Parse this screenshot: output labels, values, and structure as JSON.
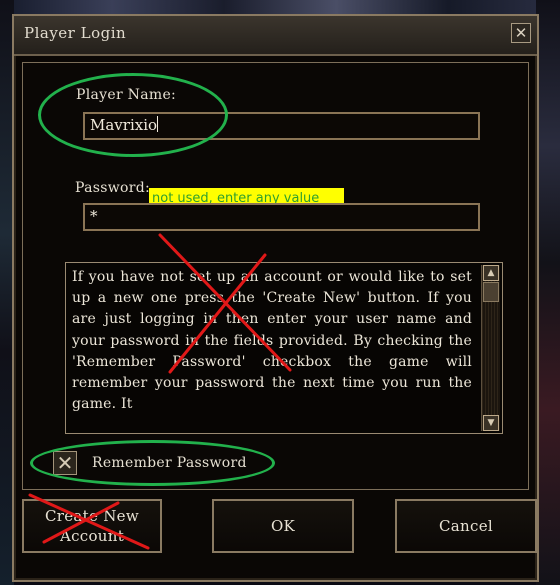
{
  "window": {
    "title": "Player Login",
    "close_glyph": "✕"
  },
  "form": {
    "player_name_label": "Player Name:",
    "player_name_value": "Mavrixio",
    "password_label": "Password:",
    "password_value": "*"
  },
  "annotation": {
    "password_note": "not used, enter any value"
  },
  "info_text": "If you have not set up an account or would like to set up a new one press the 'Create New' button. If you are just logging in then enter your user name and your password in the fields provided. By checking the 'Remember Password' checkbox the game will remember your password the next time you run the game. It",
  "scrollbar": {
    "up_glyph": "▲",
    "down_glyph": "▼"
  },
  "remember": {
    "label": "Remember Password",
    "checked_glyph": "✕"
  },
  "buttons": {
    "create_line1": "Create New",
    "create_line2": "Account",
    "ok": "OK",
    "cancel": "Cancel"
  },
  "colors": {
    "annotation_green": "#22b14c",
    "annotation_red": "#e01818",
    "note_background": "#ffff00"
  }
}
